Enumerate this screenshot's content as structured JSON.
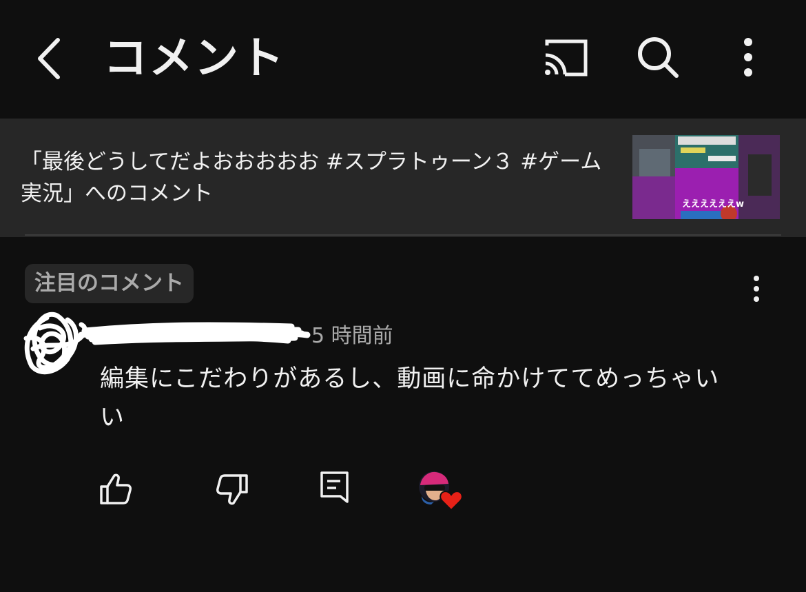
{
  "header": {
    "title": "コメント",
    "icons": [
      "back-arrow-icon",
      "cast-icon",
      "search-icon",
      "more-vert-icon"
    ]
  },
  "video": {
    "title": "「最後どうしてだよおおおおお #スプラトゥーン３ #ゲーム実況」へのコメント",
    "thumbnail": {
      "caption": "ええええええw"
    }
  },
  "comment": {
    "pinned_label": "注目のコメント",
    "time": "5 時間前",
    "text": "編集にこだわりがあるし、動画に命かけててめっちゃいい",
    "actions": [
      "like-icon",
      "dislike-icon",
      "reply-icon",
      "creator-heart-icon"
    ]
  },
  "colors": {
    "background": "#0f0f0f",
    "banner": "#272727",
    "heart": "#e62117",
    "secondary_text": "#aaaaaa"
  }
}
